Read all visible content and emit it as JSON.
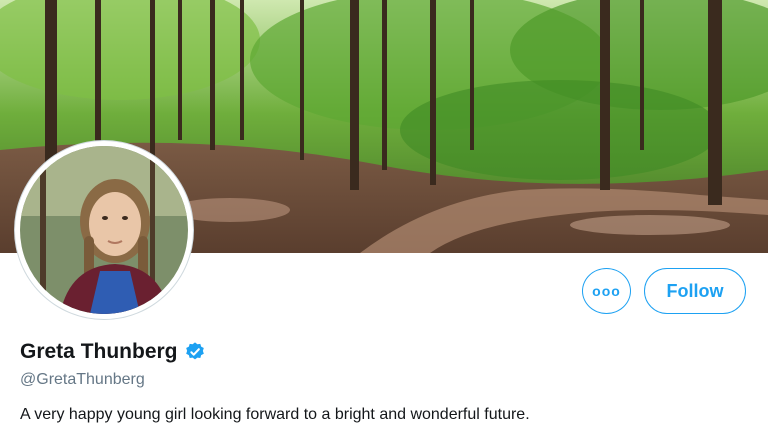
{
  "profile": {
    "display_name": "Greta Thunberg",
    "handle": "@GretaThunberg",
    "bio": "A very happy young girl looking forward to a bright and wonderful future.",
    "verified": true
  },
  "actions": {
    "more_label": "ooo",
    "follow_label": "Follow"
  },
  "icons": {
    "more": "more-options-icon",
    "verified": "verified-badge-icon"
  },
  "colors": {
    "accent": "#1da1f2",
    "name_text": "#14171a",
    "handle_text": "#657786"
  }
}
